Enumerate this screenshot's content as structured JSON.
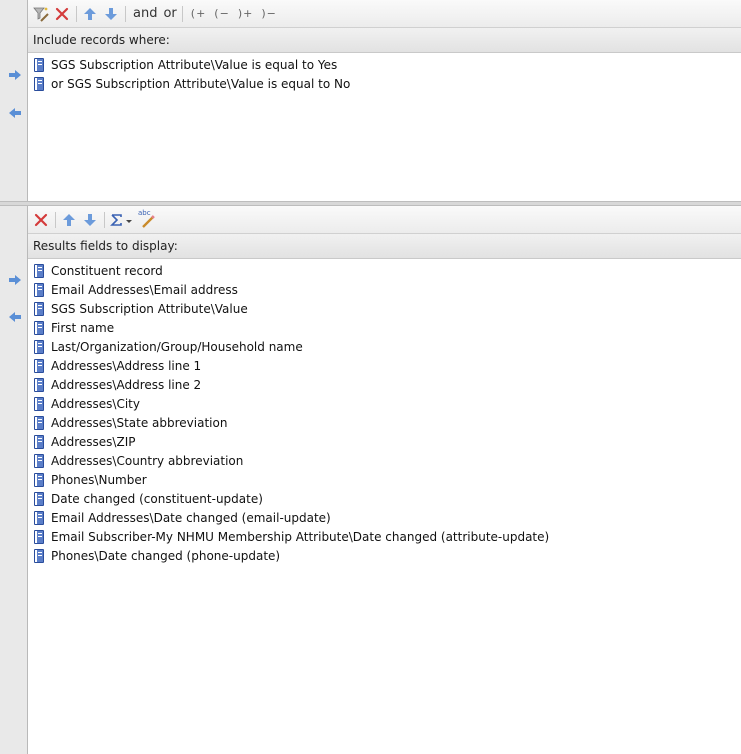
{
  "criteria": {
    "toolbar": {
      "and_label": "and",
      "or_label": "or",
      "open_paren_add": "(+",
      "open_paren_remove": "(−",
      "close_paren_add": ")+",
      "close_paren_remove": ")−"
    },
    "header": "Include records where:",
    "items": [
      {
        "label": "SGS Subscription Attribute\\Value is equal to Yes"
      },
      {
        "label": "or SGS Subscription Attribute\\Value is equal to No"
      }
    ]
  },
  "results": {
    "toolbar": {
      "spell_label": "abc"
    },
    "header": "Results fields to display:",
    "items": [
      {
        "label": "Constituent record"
      },
      {
        "label": "Email Addresses\\Email address"
      },
      {
        "label": "SGS Subscription Attribute\\Value"
      },
      {
        "label": "First name"
      },
      {
        "label": "Last/Organization/Group/Household name"
      },
      {
        "label": "Addresses\\Address line 1"
      },
      {
        "label": "Addresses\\Address line 2"
      },
      {
        "label": "Addresses\\City"
      },
      {
        "label": "Addresses\\State abbreviation"
      },
      {
        "label": "Addresses\\ZIP"
      },
      {
        "label": "Addresses\\Country abbreviation"
      },
      {
        "label": "Phones\\Number"
      },
      {
        "label": "Date changed (constituent-update)"
      },
      {
        "label": "Email Addresses\\Date changed (email-update)"
      },
      {
        "label": "Email Subscriber-My NHMU Membership Attribute\\Date changed (attribute-update)"
      },
      {
        "label": "Phones\\Date changed (phone-update)"
      }
    ]
  },
  "colors": {
    "arrow_blue": "#5a8fd6",
    "delete_red": "#d43b3b"
  }
}
